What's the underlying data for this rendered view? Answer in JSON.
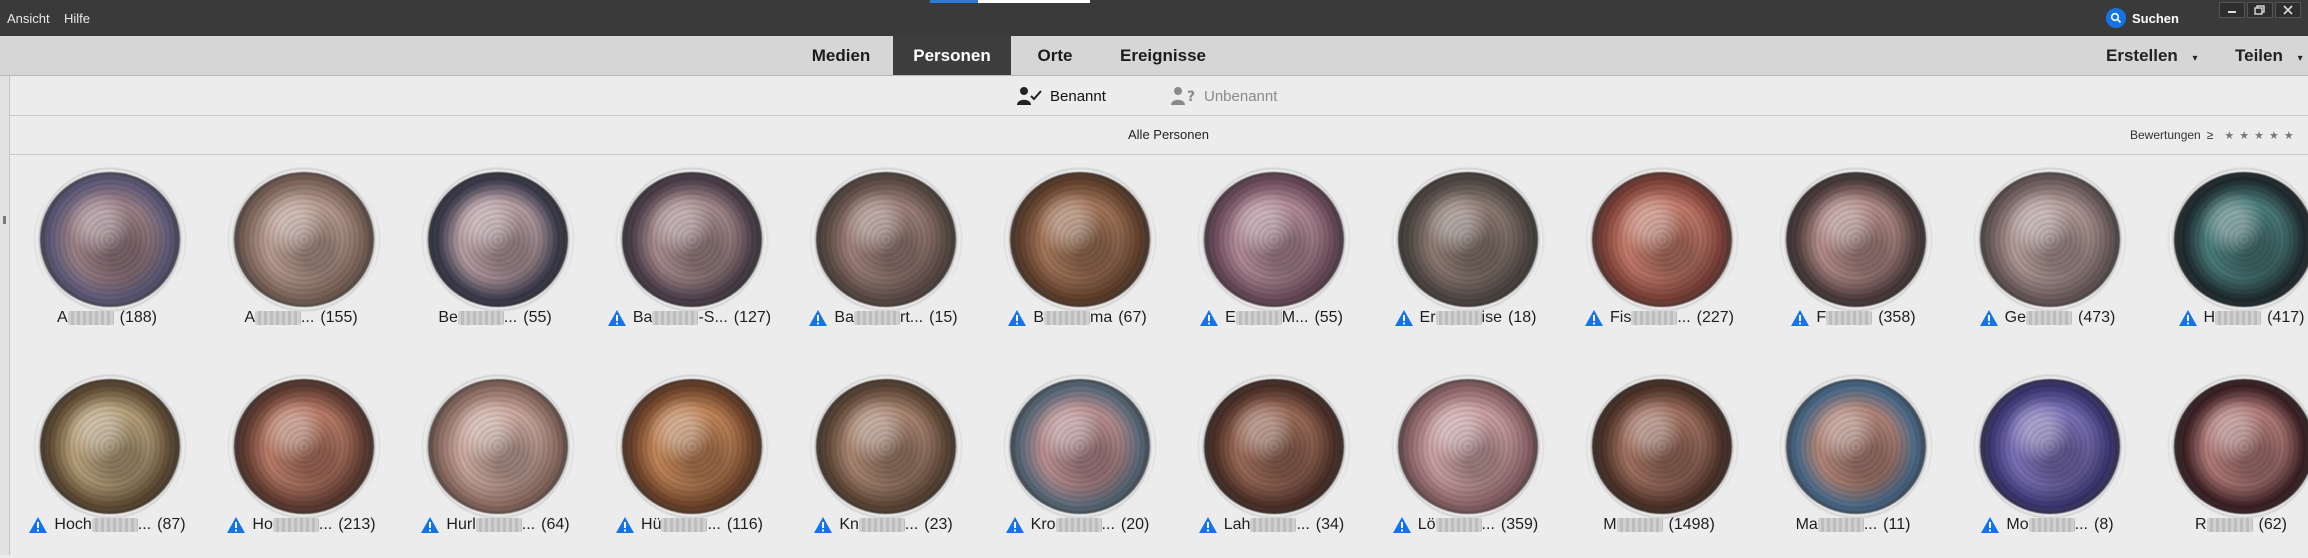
{
  "menu": {
    "view": "Ansicht",
    "help": "Hilfe"
  },
  "search": {
    "label": "Suchen",
    "icon": "search-icon"
  },
  "window_controls": [
    "minimize-icon",
    "restore-icon",
    "close-icon"
  ],
  "tabs": [
    {
      "label": "Medien",
      "active": false
    },
    {
      "label": "Personen",
      "active": true
    },
    {
      "label": "Orte",
      "active": false
    },
    {
      "label": "Ereignisse",
      "active": false
    }
  ],
  "actions": {
    "create": "Erstellen",
    "share": "Teilen"
  },
  "subtabs": [
    {
      "label": "Benannt",
      "active": true,
      "icon": "person-check-icon"
    },
    {
      "label": "Unbenannt",
      "active": false,
      "icon": "person-question-icon"
    }
  ],
  "filter": {
    "title": "Alle Personen",
    "ratings_label": "Bewertungen",
    "ratings_op": "≥"
  },
  "colors": {
    "accent": "#1473e6",
    "titlebar": "#3a3a3a",
    "active_tab": "#3d3d3d",
    "warning": "#1473e6"
  },
  "people": [
    {
      "prefix": "A",
      "suffix": "",
      "count": "(188)",
      "warning": false,
      "c1": "#9a7f86",
      "c2": "#5e5a7a"
    },
    {
      "prefix": "A",
      "suffix": "...",
      "count": "(155)",
      "warning": false,
      "c1": "#b79b90",
      "c2": "#7a6258"
    },
    {
      "prefix": "Be",
      "suffix": "...",
      "count": "(55)",
      "warning": false,
      "c1": "#b59ca2",
      "c2": "#3a3a4c"
    },
    {
      "prefix": "Ba",
      "suffix": "-S...",
      "count": "(127)",
      "warning": true,
      "c1": "#a58a8c",
      "c2": "#4c3e4a"
    },
    {
      "prefix": "Ba",
      "suffix": "rt...",
      "count": "(15)",
      "warning": true,
      "c1": "#9c7f78",
      "c2": "#5a4a44"
    },
    {
      "prefix": "B",
      "suffix": "ma",
      "count": "(67)",
      "warning": true,
      "c1": "#a27458",
      "c2": "#5e3e2a"
    },
    {
      "prefix": "E",
      "suffix": "M...",
      "count": "(55)",
      "warning": true,
      "c1": "#b08a96",
      "c2": "#6a4a5a"
    },
    {
      "prefix": "Er",
      "suffix": "ise",
      "count": "(18)",
      "warning": true,
      "c1": "#8c7a72",
      "c2": "#4e4642"
    },
    {
      "prefix": "Fis",
      "suffix": "...",
      "count": "(227)",
      "warning": true,
      "c1": "#c27a6a",
      "c2": "#7a3e36"
    },
    {
      "prefix": "F",
      "suffix": "",
      "count": "(358)",
      "warning": true,
      "c1": "#b08a86",
      "c2": "#4a3a3a"
    },
    {
      "prefix": "Ge",
      "suffix": "",
      "count": "(473)",
      "warning": true,
      "c1": "#b09a96",
      "c2": "#6a5a5a"
    },
    {
      "prefix": "H",
      "suffix": "",
      "count": "(417)",
      "warning": true,
      "c1": "#4a7a7a",
      "c2": "#1e2a2e"
    },
    {
      "prefix": "Hoch",
      "suffix": "...",
      "count": "(87)",
      "warning": true,
      "c1": "#b6a07a",
      "c2": "#5e4a32"
    },
    {
      "prefix": "Ho",
      "suffix": "...",
      "count": "(213)",
      "warning": true,
      "c1": "#b87a66",
      "c2": "#5e3a30"
    },
    {
      "prefix": "Hurl",
      "suffix": "...",
      "count": "(64)",
      "warning": true,
      "c1": "#caa89e",
      "c2": "#8a6a60"
    },
    {
      "prefix": "Hü",
      "suffix": "...",
      "count": "(116)",
      "warning": true,
      "c1": "#c08458",
      "c2": "#6a4028"
    },
    {
      "prefix": "Kn",
      "suffix": "...",
      "count": "(23)",
      "warning": true,
      "c1": "#a88470",
      "c2": "#5a4434"
    },
    {
      "prefix": "Kro",
      "suffix": "...",
      "count": "(20)",
      "warning": true,
      "c1": "#b88e90",
      "c2": "#5a6a7a"
    },
    {
      "prefix": "Lah",
      "suffix": "...",
      "count": "(34)",
      "warning": true,
      "c1": "#9a6a58",
      "c2": "#4a2e26"
    },
    {
      "prefix": "Lö",
      "suffix": "...",
      "count": "(359)",
      "warning": true,
      "c1": "#caa0a2",
      "c2": "#8a6266"
    },
    {
      "prefix": "M",
      "suffix": "",
      "count": "(1498)",
      "warning": false,
      "c1": "#a07060",
      "c2": "#4a3026"
    },
    {
      "prefix": "Ma",
      "suffix": "...",
      "count": "(11)",
      "warning": false,
      "c1": "#b08478",
      "c2": "#4a6a8a"
    },
    {
      "prefix": "Mo",
      "suffix": "...",
      "count": "(8)",
      "warning": true,
      "c1": "#7a70b6",
      "c2": "#3a3470"
    },
    {
      "prefix": "R",
      "suffix": "",
      "count": "(62)",
      "warning": false,
      "c1": "#b07a78",
      "c2": "#3a1e22"
    }
  ]
}
